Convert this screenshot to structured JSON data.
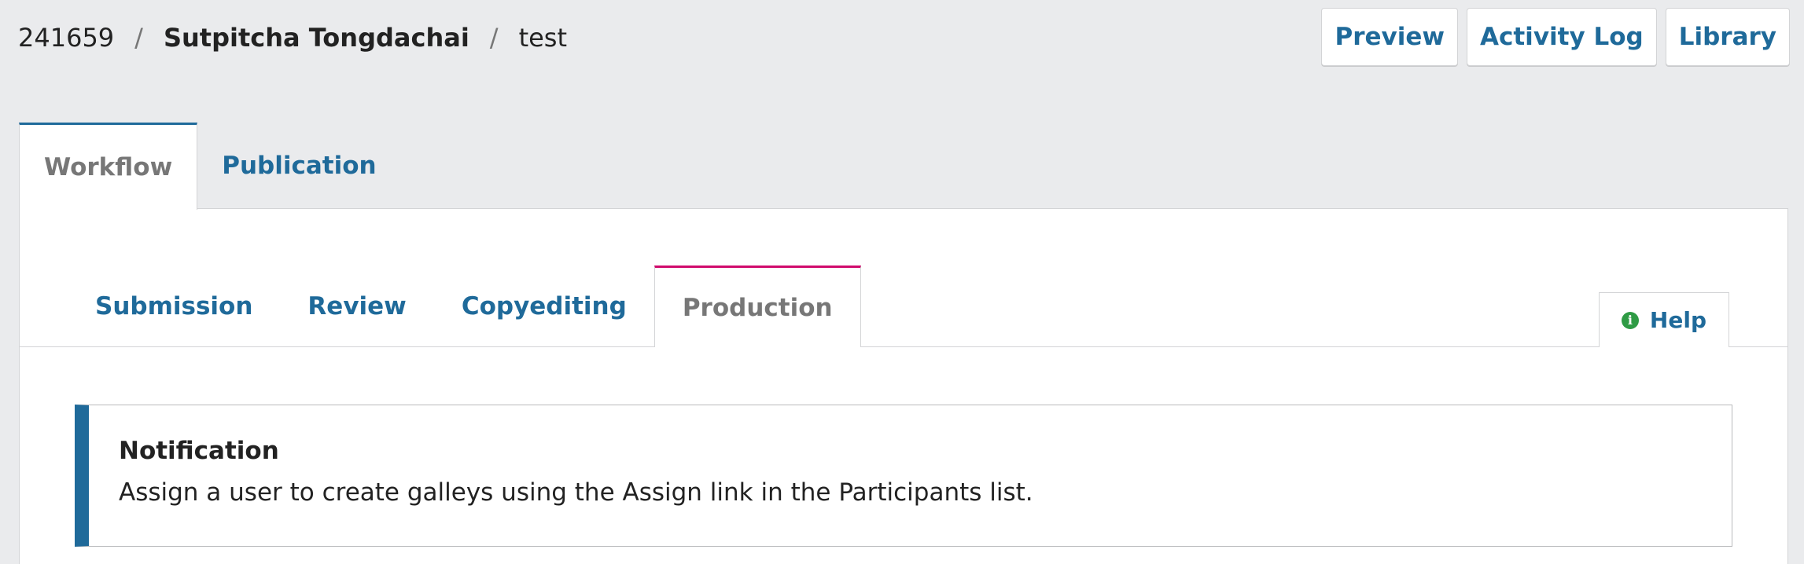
{
  "breadcrumb": {
    "id": "241659",
    "separator": "/",
    "author": "Sutpitcha Tongdachai",
    "title": "test"
  },
  "header_actions": {
    "preview": "Preview",
    "activity_log": "Activity Log",
    "library": "Library"
  },
  "main_tabs": [
    {
      "label": "Workflow",
      "active": true
    },
    {
      "label": "Publication",
      "active": false
    }
  ],
  "stage_tabs": [
    {
      "label": "Submission",
      "active": false
    },
    {
      "label": "Review",
      "active": false
    },
    {
      "label": "Copyediting",
      "active": false
    },
    {
      "label": "Production",
      "active": true
    }
  ],
  "help": {
    "label": "Help",
    "icon": "info-icon",
    "icon_glyph": "i"
  },
  "notification": {
    "title": "Notification",
    "message": "Assign a user to create galleys using the Assign link in the Participants list."
  },
  "colors": {
    "accent": "#1f6a9a",
    "stage_active": "#d00a6c",
    "help_icon": "#2f9b45",
    "background": "#eaebed"
  }
}
